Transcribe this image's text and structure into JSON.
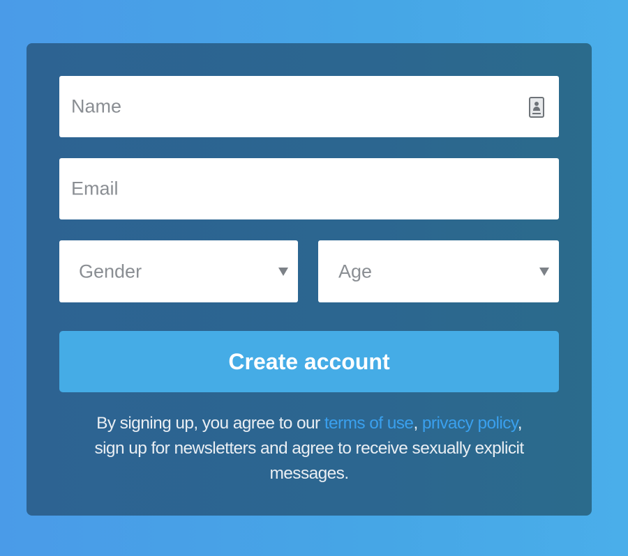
{
  "form": {
    "name_placeholder": "Name",
    "email_placeholder": "Email",
    "gender_placeholder": "Gender",
    "age_placeholder": "Age",
    "create_button_label": "Create account"
  },
  "legal": {
    "text_1": "By signing up, you agree to our ",
    "terms_link": "terms of use",
    "comma": ", ",
    "privacy_link": "privacy policy",
    "text_2": ", sign up for newsletters and agree to receive sexually explicit messages."
  },
  "icons": {
    "name_field_icon": "contact-card-icon",
    "select_arrow": "triangle-down"
  },
  "colors": {
    "page_background": "#4aa2e7",
    "card_background": "#2c6590",
    "button_background": "#45ace6",
    "link": "#3aa0ee"
  }
}
